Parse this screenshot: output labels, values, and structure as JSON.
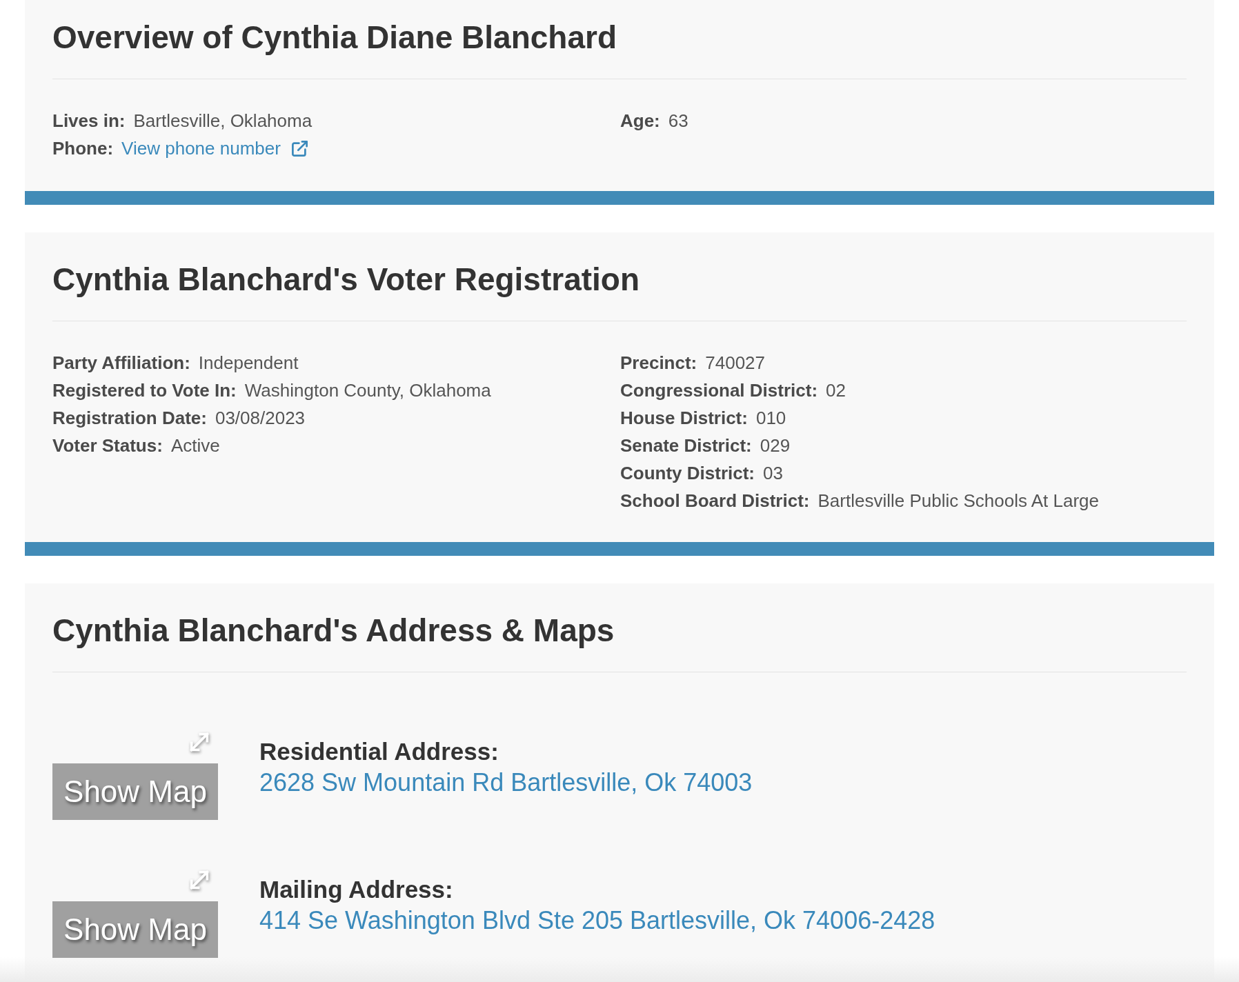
{
  "overview": {
    "title": "Overview of Cynthia Diane Blanchard",
    "left": [
      {
        "label": "Lives in:",
        "value": "Bartlesville, Oklahoma",
        "kind": "text"
      },
      {
        "label": "Phone:",
        "value": "View phone number",
        "kind": "link"
      }
    ],
    "right": [
      {
        "label": "Age:",
        "value": "63",
        "kind": "text"
      }
    ]
  },
  "voter_registration": {
    "title": "Cynthia Blanchard's Voter Registration",
    "left": [
      {
        "label": "Party Affiliation:",
        "value": "Independent",
        "kind": "text"
      },
      {
        "label": "Registered to Vote In:",
        "value": "Washington County, Oklahoma",
        "kind": "text"
      },
      {
        "label": "Registration Date:",
        "value": "03/08/2023",
        "kind": "text"
      },
      {
        "label": "Voter Status:",
        "value": "Active",
        "kind": "text"
      }
    ],
    "right": [
      {
        "label": "Precinct:",
        "value": "740027",
        "kind": "text"
      },
      {
        "label": "Congressional District:",
        "value": "02",
        "kind": "text"
      },
      {
        "label": "House District:",
        "value": "010",
        "kind": "text"
      },
      {
        "label": "Senate District:",
        "value": "029",
        "kind": "text"
      },
      {
        "label": "County District:",
        "value": "03",
        "kind": "text"
      },
      {
        "label": "School Board District:",
        "value": "Bartlesville Public Schools At Large",
        "kind": "text"
      }
    ]
  },
  "addresses": {
    "title": "Cynthia Blanchard's Address & Maps",
    "items": [
      {
        "label": "Residential Address:",
        "address": "2628 Sw Mountain Rd Bartlesville, Ok 74003",
        "button": "Show Map"
      },
      {
        "label": "Mailing Address:",
        "address": "414 Se Washington Blvd Ste 205 Bartlesville, Ok 74006-2428",
        "button": "Show Map"
      }
    ]
  }
}
